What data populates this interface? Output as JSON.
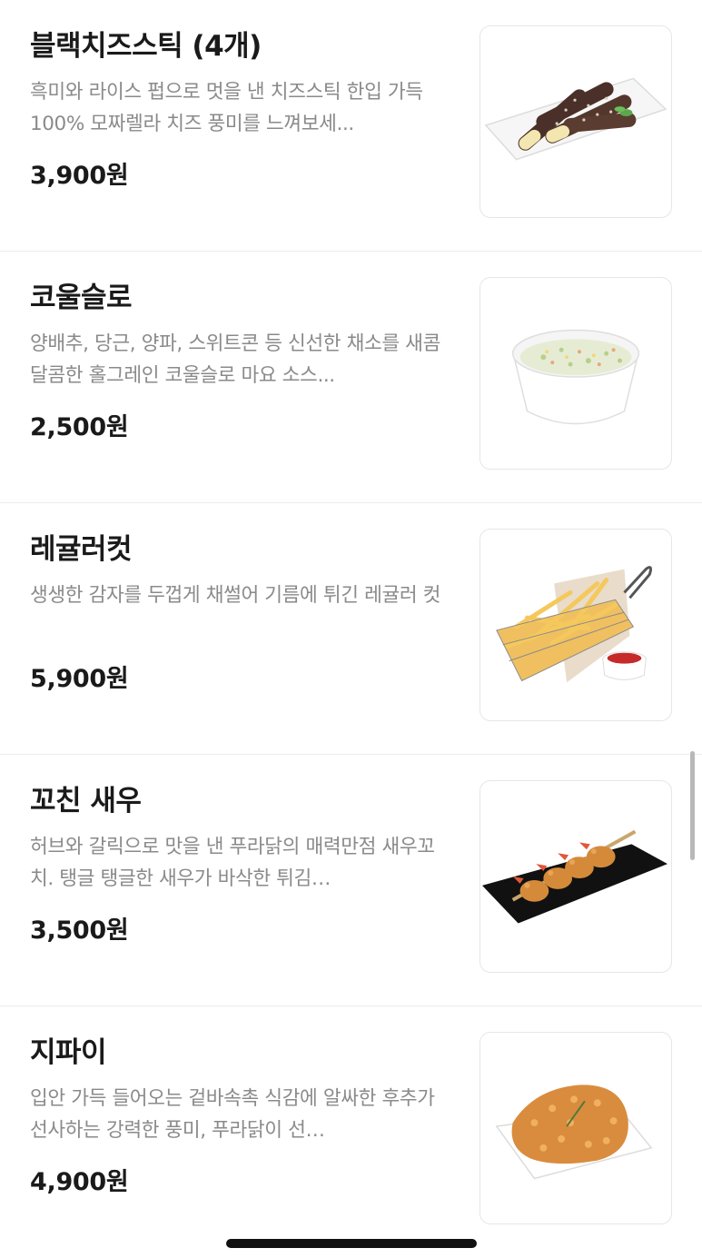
{
  "menu": {
    "items": [
      {
        "title": "블랙치즈스틱 (4개)",
        "description": "흑미와 라이스 펍으로 멋을 낸 치즈스틱 한입 가득 100% 모짜렐라 치즈 풍미를 느껴보세...",
        "price": "3,900원",
        "image_icon": "black-cheese-stick-photo"
      },
      {
        "title": "코울슬로",
        "description": "양배추, 당근, 양파, 스위트콘 등 신선한 채소를 새콤달콤한 홀그레인 코울슬로 마요 소스...",
        "price": "2,500원",
        "image_icon": "coleslaw-photo"
      },
      {
        "title": "레귤러컷",
        "description": "생생한 감자를 두껍게 채썰어 기름에 튀긴 레귤러 컷",
        "price": "5,900원",
        "image_icon": "regular-cut-fries-photo"
      },
      {
        "title": "꼬친 새우",
        "description": "허브와 갈릭으로 맛을 낸 푸라닭의 매력만점 새우꼬치. 탱글 탱글한 새우가 바삭한 튀김…",
        "price": "3,500원",
        "image_icon": "shrimp-skewer-photo"
      },
      {
        "title": "지파이",
        "description": "입안 가득 들어오는 겉바속촉 식감에 알싸한 후추가 선사하는 강력한 풍미, 푸라닭이 선…",
        "price": "4,900원",
        "image_icon": "chicken-pie-photo"
      }
    ]
  },
  "colors": {
    "title": "#1a1a1a",
    "description": "#8a8a8a",
    "divider": "#ececec",
    "background": "#ffffff"
  }
}
